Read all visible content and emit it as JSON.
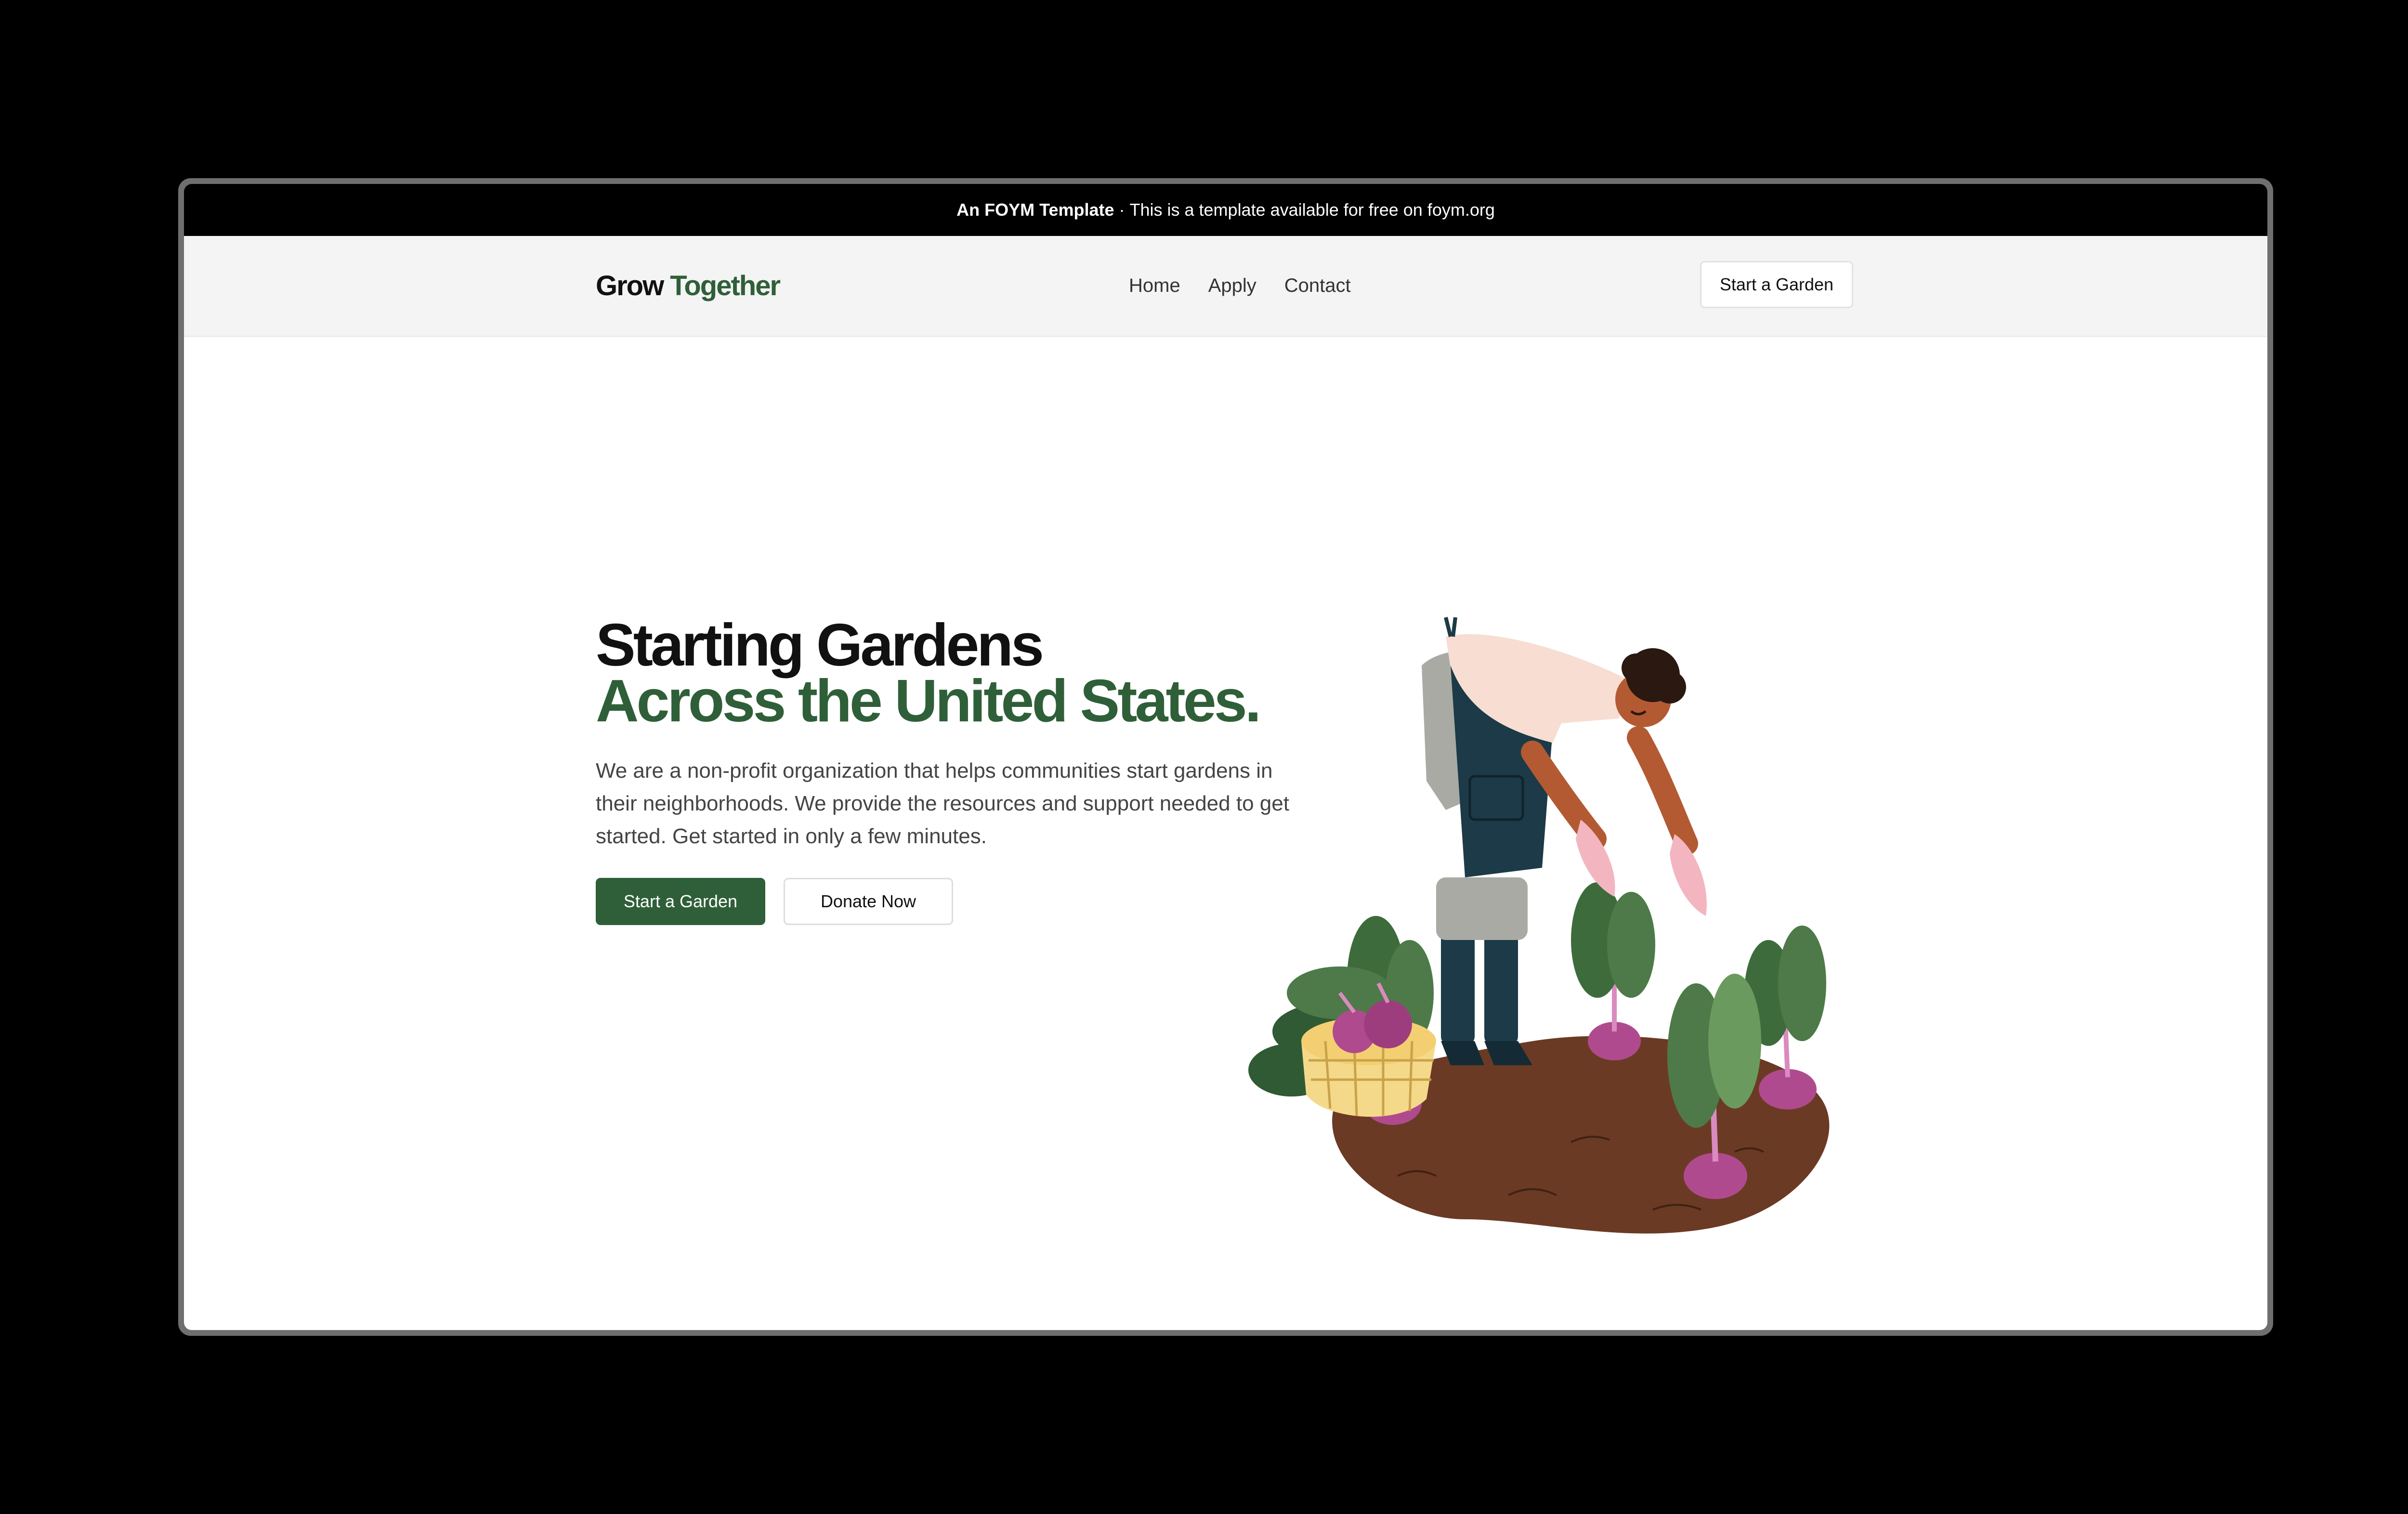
{
  "announcement": {
    "strong": "An FOYM Template",
    "separator": "·",
    "text": "This is a template available for free on foym.org"
  },
  "header": {
    "logo_primary": "Grow",
    "logo_accent": "Together",
    "nav": [
      {
        "label": "Home"
      },
      {
        "label": "Apply"
      },
      {
        "label": "Contact"
      }
    ],
    "cta_label": "Start a Garden"
  },
  "hero": {
    "title_line1": "Starting Gardens",
    "title_line2": "Across the United States.",
    "description": "We are a non-profit organization that helps communities start gardens in their neighborhoods. We provide the resources and support needed to get started. Get started in only a few minutes.",
    "primary_button": "Start a Garden",
    "secondary_button": "Donate Now"
  },
  "colors": {
    "brand_green": "#2f5f38",
    "announcement_bg": "#000000",
    "header_bg": "#f4f4f4",
    "soil": "#6b3a24",
    "beet": "#b04a8e",
    "leaf": "#4d7a48"
  }
}
